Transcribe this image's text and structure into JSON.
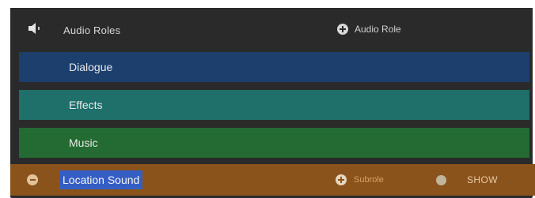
{
  "header": {
    "icon": "speaker-icon",
    "title": "Audio Roles",
    "add_role_icon": "plus-circle-icon",
    "add_role_label": "Audio Role"
  },
  "roles": [
    {
      "label": "Dialogue",
      "color": "#1c3f6e"
    },
    {
      "label": "Effects",
      "color": "#1f6f6b"
    },
    {
      "label": "Music",
      "color": "#236b32"
    }
  ],
  "subrole": {
    "name": "Location Sound",
    "color": "#8a531c",
    "selected": true,
    "remove_icon": "minus-circle-icon",
    "add_subrole_icon": "plus-circle-icon",
    "add_subrole_label": "Subrole",
    "show_label": "SHOW"
  }
}
